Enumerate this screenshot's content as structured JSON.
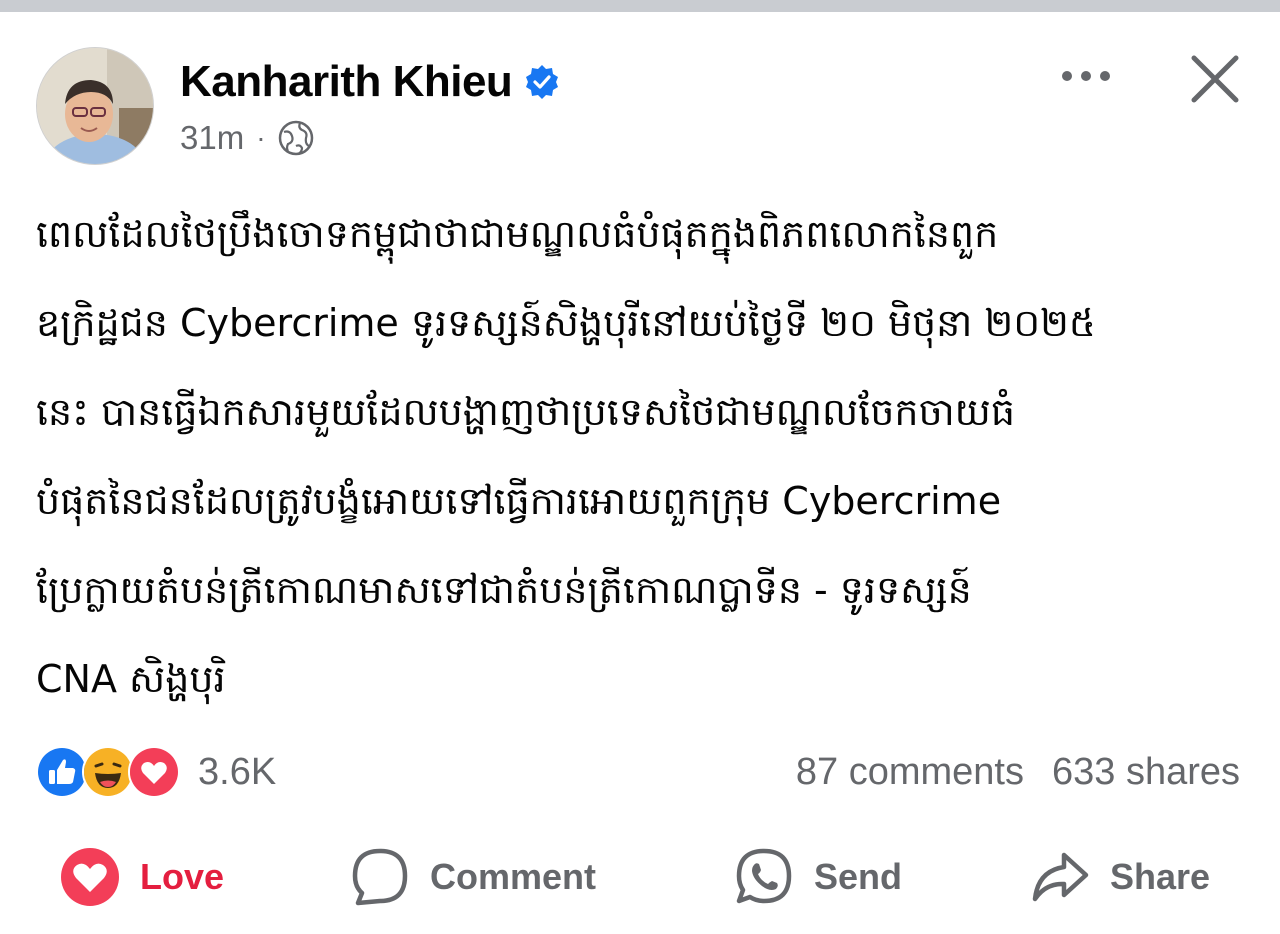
{
  "post": {
    "author": "Kanharith Khieu",
    "time": "31m",
    "separator": "·",
    "text_lines": [
      "ពេលដែលថៃប្រឹងចោទកម្ពុជាថាជាមណ្ឌលធំបំផុតក្នុងពិភពលោកនៃពួក",
      "ឧក្រិដ្ឋជន Cybercrime ទូរទស្សន៍សិង្ហបុរីនៅយប់ថ្ងៃទី ២០ មិថុនា ២០២៥",
      "នេះ បានធ្វើឯកសារមួយដែលបង្ហាញថាប្រទេសថៃជាមណ្ឌលចែកចាយធំ",
      "បំផុតនៃជនដែលត្រូវបង្ខំអោយទៅធ្វើការអោយពួកក្រុម Cybercrime",
      "ប្រែក្លាយតំបន់ត្រីកោណមាសទៅជាតំបន់ត្រីកោណប្លាទីន - ទូរទស្សន៍",
      "CNA សិង្ហបុរិ"
    ]
  },
  "stats": {
    "reactions_count": "3.6K",
    "comments": "87 comments",
    "shares": "633 shares"
  },
  "actions": {
    "love": "Love",
    "comment": "Comment",
    "send": "Send",
    "share": "Share"
  },
  "icons": {
    "verified": "verified-badge-icon",
    "audience": "globe-icon",
    "more": "more-options-icon",
    "close": "close-icon"
  },
  "colors": {
    "verified_blue": "#1877f2",
    "love_red": "#e41e3f",
    "secondary_text": "#65676b"
  }
}
